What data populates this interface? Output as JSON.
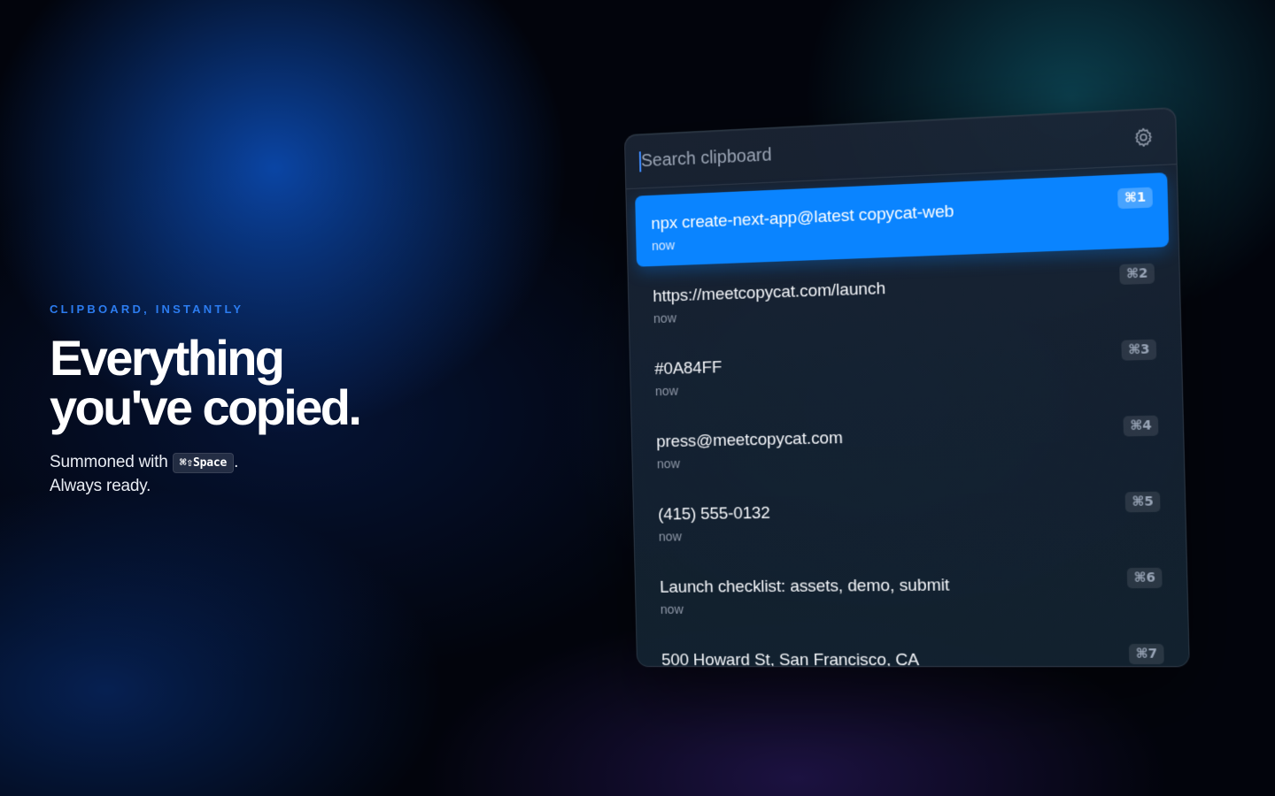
{
  "hero": {
    "eyebrow": "CLIPBOARD, INSTANTLY",
    "headline_line1": "Everything",
    "headline_line2": "you've copied.",
    "sub_prefix": "Summoned with",
    "shortcut": "⌘⇧Space",
    "sub_suffix": ".",
    "sub_line2": "Always ready."
  },
  "panel": {
    "search_placeholder": "Search clipboard",
    "settings_icon": "gear-icon",
    "accent_color": "#0a84ff",
    "items": [
      {
        "text": "npx create-next-app@latest copycat-web",
        "time": "now",
        "shortcut": "⌘1",
        "selected": true
      },
      {
        "text": "https://meetcopycat.com/launch",
        "time": "now",
        "shortcut": "⌘2",
        "selected": false
      },
      {
        "text": "#0A84FF",
        "time": "now",
        "shortcut": "⌘3",
        "selected": false
      },
      {
        "text": "press@meetcopycat.com",
        "time": "now",
        "shortcut": "⌘4",
        "selected": false
      },
      {
        "text": "(415) 555-0132",
        "time": "now",
        "shortcut": "⌘5",
        "selected": false
      },
      {
        "text": "Launch checklist: assets, demo, submit",
        "time": "now",
        "shortcut": "⌘6",
        "selected": false
      },
      {
        "text": "500 Howard St, San Francisco, CA",
        "time": "",
        "shortcut": "⌘7",
        "selected": false
      }
    ]
  }
}
